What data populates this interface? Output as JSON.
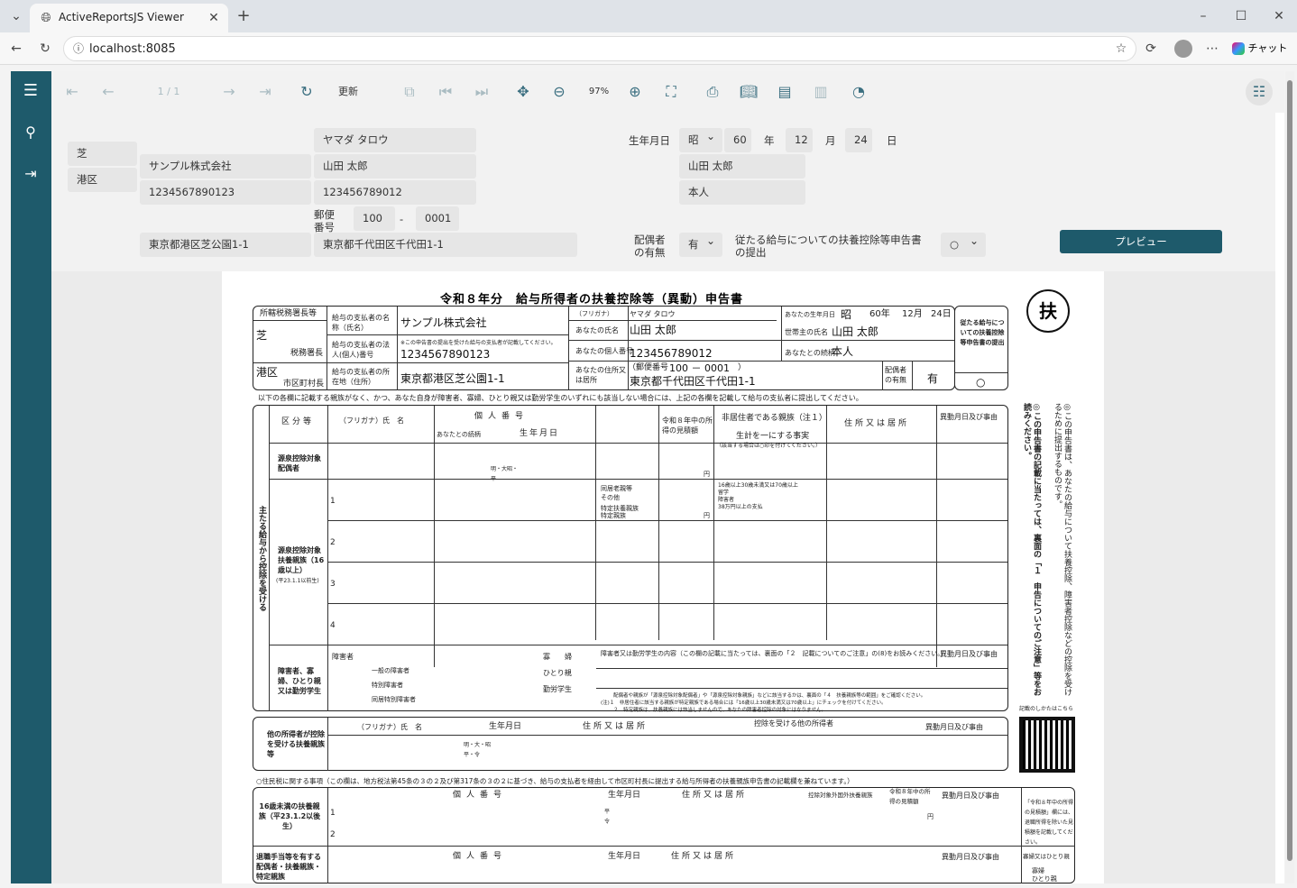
{
  "browser": {
    "tab_title": "ActiveReportsJS Viewer",
    "url": "localhost:8085",
    "chat_label": "チャット"
  },
  "toolbar": {
    "page_indicator": "1 / 1",
    "refresh_label": "更新",
    "zoom_level": "97%"
  },
  "params": {
    "row1": {
      "kana_name": "ヤマダ タロウ",
      "birth_label": "生年月日",
      "era": "昭",
      "year": "60",
      "year_unit": "年",
      "month": "12",
      "month_unit": "月",
      "day": "24",
      "day_unit": "日"
    },
    "tax_office_city": "芝",
    "city_ward": "港区",
    "payer_name": "サンプル株式会社",
    "payer_number": "1234567890123",
    "person_name": "山田 太郎",
    "personal_number": "123456789012",
    "householder_name": "山田 太郎",
    "relationship": "本人",
    "postal_label": "郵便番号",
    "postal_first": "100",
    "postal_sep": "-",
    "postal_second": "0001",
    "payer_address": "東京都港区芝公園1-1",
    "person_address": "東京都千代田区千代田1-1",
    "spouse_label": "配偶者の有無",
    "spouse_value": "有",
    "main_salary_label": "従たる給与についての扶養控除等申告書の提出",
    "main_salary_value": "○",
    "preview_button": "プレビュー"
  },
  "form": {
    "title": "令和８年分　給与所得者の扶養控除等（異動）申告書",
    "stamp": "扶",
    "tax_office_header": "所轄税務署長等",
    "tax_office_value": "芝",
    "tax_office_suffix": "税務署長",
    "city_value": "港区",
    "city_suffix": "市区町村長",
    "payer_name_label": "給与の支払者の名称（氏名）",
    "payer_name_value": "サンプル株式会社",
    "payer_number_label": "給与の支払者の法人(個人)番号",
    "payer_number_note": "※この申告書の提出を受けた給与の支払者が記載してください。",
    "payer_number_value": "1234567890123",
    "payer_address_label": "給与の支払者の所在地（住所）",
    "payer_address_value": "東京都港区芝公園1-1",
    "furigana_label": "（フリガナ）",
    "furigana_value": "ヤマダ タロウ",
    "your_name_label": "あなたの氏名",
    "your_name_value": "山田 太郎",
    "your_number_label": "あなたの個人番号",
    "your_number_value": "123456789012",
    "your_address_label": "あなたの住所又は居所",
    "postal_prefix": "（郵便番号",
    "postal_value": "100 － 0001",
    "postal_suffix": "）",
    "address_value": "東京都千代田区千代田1-1",
    "birth_label": "あなたの生年月日",
    "birth_era": "昭",
    "birth_year": "60年",
    "birth_month": "12月",
    "birth_day": "24日",
    "householder_label": "世帯主の氏名",
    "householder_value": "山田 太郎",
    "relation_label": "あなたとの続柄",
    "relation_value": "本人",
    "spouse_label": "配偶者の有無",
    "spouse_value": "有",
    "sub_label": "従たる給与についての扶養控除等申告書の提出",
    "sub_value": "○",
    "instruction": "以下の各欄に記載する親族がなく、かつ、あなた自身が障害者、寡婦、ひとり親又は勤労学生のいずれにも該当しない場合には、上記の各欄を記載して給与の支払者に提出してください。",
    "col_category": "区分等",
    "col_name": "（フリガナ）氏　名",
    "col_number": "個人番号",
    "col_relation": "あなたとの続柄",
    "col_birth": "生年月日",
    "col_income": "令和８年中の所得の見積額",
    "col_nonresident": "非居住者である親族（注１）",
    "col_livelihood": "生計を一にする事実",
    "col_address": "住所又は居所",
    "col_change": "異動月日及び事由",
    "row_a": "源泉控除対象配偶者",
    "row_b": "源泉控除対象扶養親族（16歳以上）",
    "row_b_note": "(平23.1.1以前生)",
    "row_c": "障害者、寡婦、ひとり親又は勤労学生",
    "row_d": "他の所得者が控除を受ける扶養親族等",
    "side_main": "主たる給与から控除を受ける",
    "era_options": "明・大昭・平",
    "yen": "円",
    "check_same": "同居老親等",
    "check_other": "その他",
    "check_special": "特定扶養親族",
    "check_spec2": "特定親族",
    "check_age": "16歳以上30歳未満又は70歳以上",
    "check_study": "留学",
    "check_disabled": "障害者",
    "check_38": "38万円以上の支払",
    "row_nums": [
      "1",
      "2",
      "3",
      "4"
    ],
    "c_disabled": "障害者",
    "c_widow": "寡　　婦",
    "c_single": "ひとり親",
    "c_student": "勤労学生",
    "c_general": "一般の障害者",
    "c_special": "特別障害者",
    "c_cohabit": "同居特別障害者",
    "c_detail": "障害者又は勤労学生の内容（この欄の記載に当たっては、裏面の「２　記載についてのご注意」の(8)をお読みください。）",
    "c_note1": "配偶者や親族が「源泉控除対象配偶者」や「源泉控除対象親族」などに該当するかは、裏面の「４　扶養親族等の範囲」をご確認ください。",
    "c_note2": "(注)１　非居住者に該当する親族が特定親族である場合には「16歳以上30歳未満又は70歳以上」にチェックを付けてください。",
    "c_note3": "２　特定親族は、扶養親族には該当しませんので、あなたの障害者控除の対象にはなりません。",
    "d_deduct": "控除を受ける他の所得者",
    "resident_title": "○住民税に関する事項（この欄は、地方税法第45条の３の２及び第317条の３の２に基づき、給与の支払者を経由して市区町村長に提出する給与所得者の扶養親族申告書の記載欄を兼ねています。）",
    "res_under16": "16歳未満の扶養親族（平23.1.2以後生）",
    "res_retire": "退職手当等を有する配偶者・扶養親族・特定親族",
    "res_income": "令和８年中の所得の見積額",
    "res_nonres": "控除対象外国外扶養親族",
    "res_widow": "寡婦又はひとり親",
    "res_widow1": "寡婦",
    "res_widow2": "ひとり親",
    "res_note": "「令和８年中の所得の見積額」欄には、退職所得を除いた見積額を記載してください。",
    "right_note1": "◎この申告書は、あなたの給与について扶養控除、障害者控除などの控除を受けるために提出するものです。",
    "right_note2": "◎この申告書の記載に当たっては、裏面の「１　申告についてのご注意」等をお読みください。",
    "qr_label": "記載のしかたはこちら",
    "era_mark": "平・令",
    "era_mark2": "明・大・昭平・令",
    "nonres_sub": "（該当する場合は○印を付けてください。）",
    "res_era": "平令"
  },
  "colors": {
    "sidebar": "#1e5a6b",
    "accent": "#3b6f80",
    "button": "#1e5a6b"
  }
}
